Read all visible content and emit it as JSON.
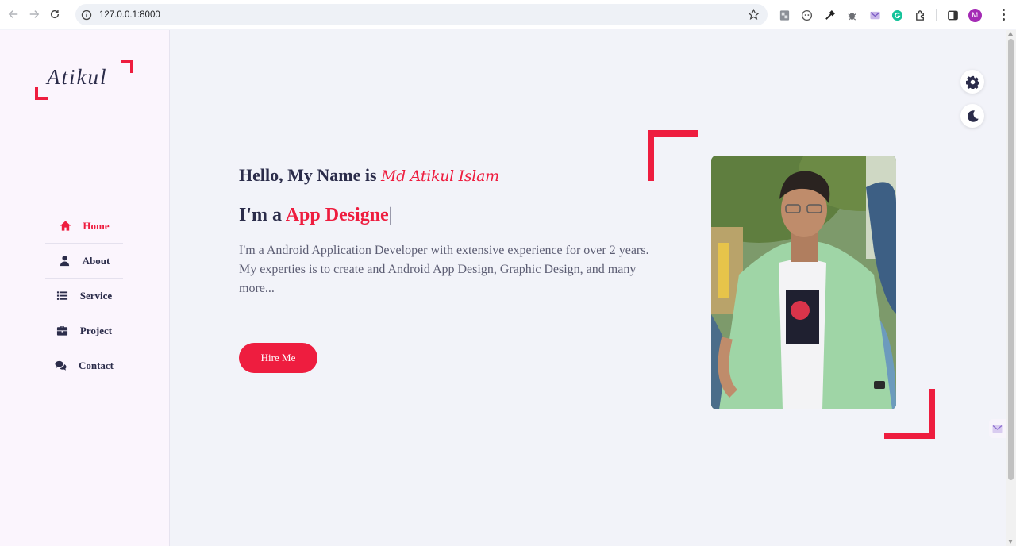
{
  "browser": {
    "url": "127.0.0.1:8000",
    "profile_initial": "M",
    "extensions": [
      "pdf-extension-icon",
      "tracker-extension-icon",
      "color-picker-icon",
      "bug-icon",
      "mail-extension-icon",
      "grammarly-icon",
      "puzzle-icon"
    ]
  },
  "sidebar": {
    "logo": "Atikul",
    "menu": [
      {
        "label": "Home",
        "icon": "home-icon",
        "active": true
      },
      {
        "label": "About",
        "icon": "user-icon",
        "active": false
      },
      {
        "label": "Service",
        "icon": "list-icon",
        "active": false
      },
      {
        "label": "Project",
        "icon": "briefcase-icon",
        "active": false
      },
      {
        "label": "Contact",
        "icon": "comments-icon",
        "active": false
      }
    ]
  },
  "hero": {
    "greeting": "Hello, My Name is",
    "name": "Md Atikul Islam",
    "role_prefix": "I'm a",
    "role_typed": "App Designe",
    "caret": "|",
    "description": "I'm a Android Application Developer with extensive experience for over 2 years. My experties is to create and Android App Design, Graphic Design, and many more...",
    "button": "Hire Me"
  },
  "colors": {
    "accent": "#ee1d3f",
    "text": "#2b2c4a",
    "background": "#f2f3f9",
    "sidebar": "#fbf5fd"
  },
  "widgets": [
    "gear-icon",
    "moon-icon"
  ]
}
